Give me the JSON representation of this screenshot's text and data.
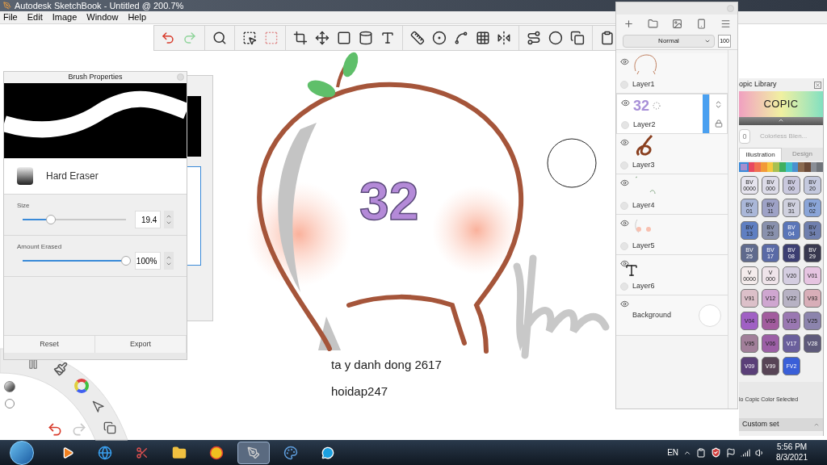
{
  "window": {
    "title": "Autodesk SketchBook - Untitled @ 200.7%"
  },
  "menu": [
    "File",
    "Edit",
    "Image",
    "Window",
    "Help"
  ],
  "canvas": {
    "lettering": "32",
    "text_lines": [
      "ta y danh dong 2617",
      "hoidap247"
    ]
  },
  "brush_properties": {
    "title": "Brush Properties",
    "brush_name": "Hard Eraser",
    "sliders": [
      {
        "label": "Size",
        "level": 0.27,
        "value": "19.4"
      },
      {
        "label": "Amount Erased",
        "level": 1.0,
        "value": "100%"
      }
    ],
    "buttons": [
      "Reset",
      "Export"
    ]
  },
  "layers": {
    "blend_mode": "Normal",
    "opacity": "100",
    "items": [
      {
        "name": "Layer1",
        "kind": "paint",
        "visible": true,
        "selected": false
      },
      {
        "name": "Layer2",
        "kind": "paint",
        "visible": true,
        "selected": true,
        "thumbnail_text": "32"
      },
      {
        "name": "Layer3",
        "kind": "paint",
        "visible": true,
        "selected": false
      },
      {
        "name": "Layer4",
        "kind": "paint",
        "visible": true,
        "selected": false
      },
      {
        "name": "Layer5",
        "kind": "paint",
        "visible": true,
        "selected": false
      },
      {
        "name": "Layer6",
        "kind": "text",
        "visible": true,
        "selected": false
      },
      {
        "name": "Background",
        "kind": "background",
        "visible": true,
        "selected": false
      }
    ]
  },
  "copic": {
    "title": "opic Library",
    "logo": "COPIC",
    "blender_code": "0",
    "blender_name": "Colorless Blen...",
    "tabs": [
      {
        "label": "Illustration",
        "selected": true
      },
      {
        "label": "Design",
        "selected": false
      }
    ],
    "strip": [
      {
        "color": "#a58fd0",
        "selected": true
      },
      {
        "color": "#e84860",
        "selected": false
      },
      {
        "color": "#f07050",
        "selected": false
      },
      {
        "color": "#f29a38",
        "selected": false
      },
      {
        "color": "#f5c840",
        "selected": false
      },
      {
        "color": "#a8c050",
        "selected": false
      },
      {
        "color": "#40b060",
        "selected": false
      },
      {
        "color": "#40c0c8",
        "selected": false
      },
      {
        "color": "#4a90d0",
        "selected": false
      },
      {
        "color": "#8a6a50",
        "selected": false
      },
      {
        "color": "#6a4a38",
        "selected": false
      },
      {
        "color": "#8a8e96",
        "selected": false
      },
      {
        "color": "#70747a",
        "selected": false
      }
    ],
    "swatches": [
      {
        "label": "BV\n0000",
        "color": "#e6e4ee"
      },
      {
        "label": "BV\n000",
        "color": "#dcdbe8"
      },
      {
        "label": "BV\n00",
        "color": "#c9c8dd"
      },
      {
        "label": "BV\n20",
        "color": "#c4c9de"
      },
      {
        "label": "BV\n01",
        "color": "#aab7d8"
      },
      {
        "label": "BV\n11",
        "color": "#9ea2c6"
      },
      {
        "label": "BV\n31",
        "color": "#cfd0de"
      },
      {
        "label": "BV\n02",
        "color": "#8aa5d8"
      },
      {
        "label": "BV\n13",
        "color": "#5f7fc2"
      },
      {
        "label": "BV\n23",
        "color": "#8991ad"
      },
      {
        "label": "BV\n04",
        "color": "#5a75b8"
      },
      {
        "label": "BV\n34",
        "color": "#6f7fae"
      },
      {
        "label": "BV\n25",
        "color": "#5f6a8d"
      },
      {
        "label": "BV\n17",
        "color": "#5a6aa6"
      },
      {
        "label": "BV\n08",
        "color": "#3c3e72"
      },
      {
        "label": "BV\n29",
        "color": "#38384f"
      },
      {
        "label": "V\n0000",
        "color": "#f4ecec"
      },
      {
        "label": "V\n000",
        "color": "#efe4ea"
      },
      {
        "label": "V20",
        "color": "#d4cde0"
      },
      {
        "label": "V01",
        "color": "#e6c4e1"
      },
      {
        "label": "V91",
        "color": "#dcc0c9"
      },
      {
        "label": "V12",
        "color": "#cfa6d0"
      },
      {
        "label": "V22",
        "color": "#b7b2c4"
      },
      {
        "label": "V93",
        "color": "#d8aeb8"
      },
      {
        "label": "V04",
        "color": "#a060c4"
      },
      {
        "label": "V05",
        "color": "#a25c9e"
      },
      {
        "label": "V15",
        "color": "#9a78b2"
      },
      {
        "label": "V25",
        "color": "#8c84ad"
      },
      {
        "label": "V95",
        "color": "#a27f9a"
      },
      {
        "label": "V06",
        "color": "#9c5fa6"
      },
      {
        "label": "V17",
        "color": "#6a5f9c"
      },
      {
        "label": "V28",
        "color": "#5e5a7a"
      },
      {
        "label": "V09",
        "color": "#5a3f78"
      },
      {
        "label": "V99",
        "color": "#574456"
      },
      {
        "label": "FV2",
        "color": "#3a5fd8"
      }
    ],
    "status": "lo Copic Color Selected",
    "custom_set": "Custom set"
  },
  "taskbar": {
    "apps": [
      {
        "selected": false
      },
      {
        "selected": false
      },
      {
        "selected": false
      },
      {
        "selected": false
      },
      {
        "selected": false
      },
      {
        "selected": true
      },
      {
        "selected": false
      },
      {
        "selected": false
      }
    ],
    "language": "EN",
    "time": "5:56 PM",
    "date": "8/3/2021"
  }
}
